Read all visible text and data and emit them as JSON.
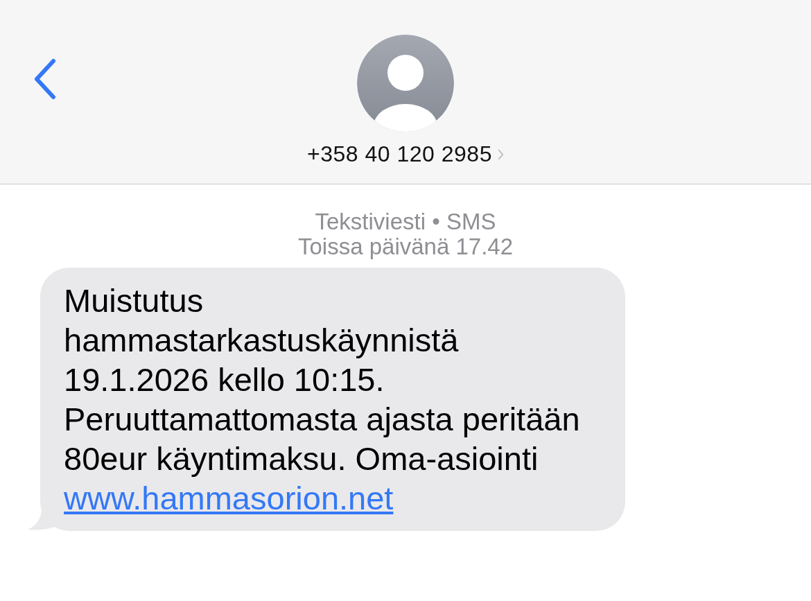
{
  "header": {
    "contact": {
      "phone": "+358 40 120 2985"
    }
  },
  "meta": {
    "service": "Tekstiviesti • SMS",
    "time": "Toissa päivänä 17.42"
  },
  "messages": [
    {
      "lines": [
        "Muistutus",
        "hammastarkastuskäynnistä",
        "19.1.2026 kello 10:15.",
        "Peruuttamattomasta ajasta peritään",
        "80eur käyntimaksu. Oma-asiointi"
      ],
      "link": "www.hammasorion.net"
    }
  ]
}
